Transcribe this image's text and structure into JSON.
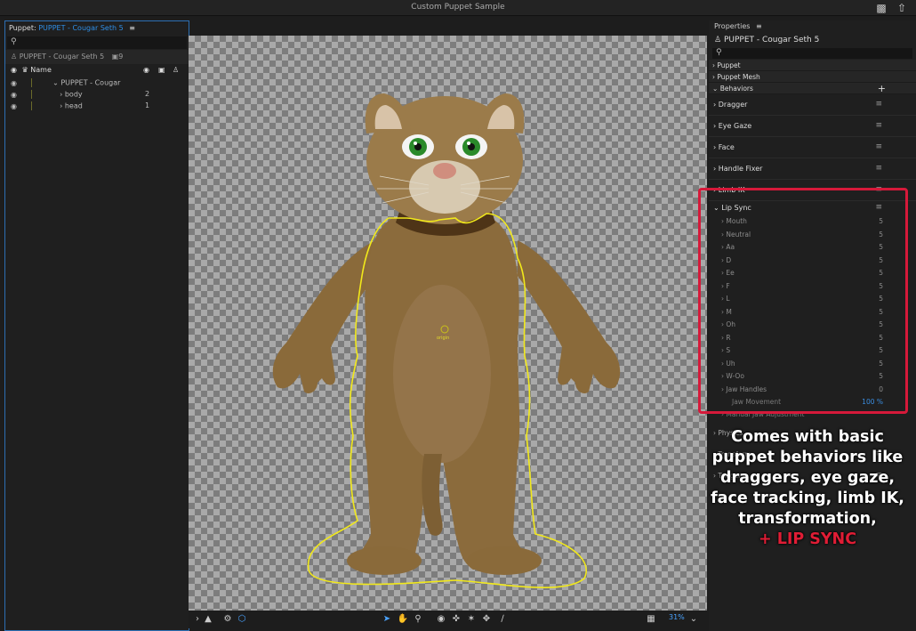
{
  "window": {
    "title": "Custom Puppet Sample",
    "icons": [
      "chat-icon",
      "share-icon"
    ]
  },
  "puppet_panel": {
    "label": "Puppet:",
    "puppet_name": "PUPPET - Cougar Seth 5",
    "search_icon": "search-icon",
    "puppet_row_name": "PUPPET - Cougar Seth 5",
    "puppet_row_count": "9",
    "column_header": "Name",
    "tree": [
      {
        "name": "PUPPET - Cougar",
        "count": ""
      },
      {
        "name": "body",
        "count": "2"
      },
      {
        "name": "head",
        "count": "1"
      }
    ]
  },
  "canvas": {
    "origin_label": "origin",
    "zoom": "31%"
  },
  "properties": {
    "title": "Properties",
    "puppet_name": "PUPPET - Cougar Seth 5",
    "sections": [
      "Puppet",
      "Puppet Mesh",
      "Behaviors"
    ],
    "behaviors": [
      "Dragger",
      "Eye Gaze",
      "Face",
      "Handle Fixer",
      "Limb IK"
    ],
    "lip_sync": {
      "label": "Lip Sync",
      "items": [
        {
          "name": "Mouth",
          "value": "5"
        },
        {
          "name": "Neutral",
          "value": "5"
        },
        {
          "name": "Aa",
          "value": "5"
        },
        {
          "name": "D",
          "value": "5"
        },
        {
          "name": "Ee",
          "value": "5"
        },
        {
          "name": "F",
          "value": "5"
        },
        {
          "name": "L",
          "value": "5"
        },
        {
          "name": "M",
          "value": "5"
        },
        {
          "name": "Oh",
          "value": "5"
        },
        {
          "name": "R",
          "value": "5"
        },
        {
          "name": "S",
          "value": "5"
        },
        {
          "name": "Uh",
          "value": "5"
        },
        {
          "name": "W-Oo",
          "value": "5"
        },
        {
          "name": "Jaw Handles",
          "value": "0"
        }
      ]
    },
    "jaw_movement": {
      "label": "Jaw Movement",
      "value": "100 %"
    },
    "manual_jaw": "Manual Jaw Adjustment",
    "lower_behaviors": [
      "Physics",
      "Transform",
      "Triggers"
    ]
  },
  "caption": {
    "lines": [
      "Comes with basic",
      "puppet behaviors like",
      "draggers, eye gaze,",
      "face tracking, limb IK,",
      "transformation,"
    ],
    "highlight": "+ LIP SYNC"
  },
  "colors": {
    "accent": "#2f8ee6",
    "highlight": "#d6193a",
    "caption_highlight": "#e01d35"
  }
}
